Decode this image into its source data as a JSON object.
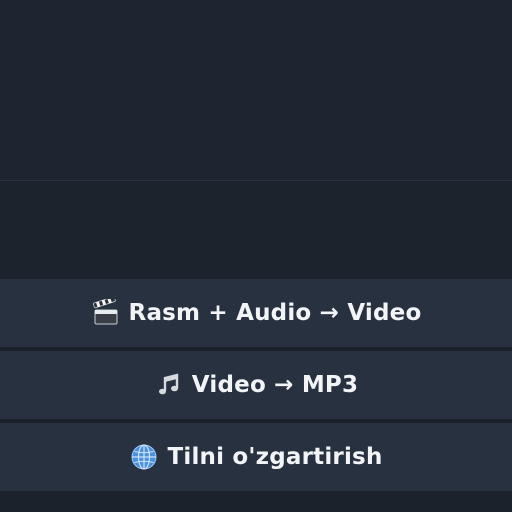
{
  "keyboard": {
    "buttons": [
      {
        "icon": "clapper-board-icon",
        "label": "Rasm + Audio → Video"
      },
      {
        "icon": "musical-note-icon",
        "label": "Video → MP3"
      },
      {
        "icon": "globe-icon",
        "label": "Tilni o'zgartirish"
      }
    ]
  },
  "colors": {
    "background": "#1d232c",
    "button": "#28313f",
    "text": "#f2f4f7"
  }
}
